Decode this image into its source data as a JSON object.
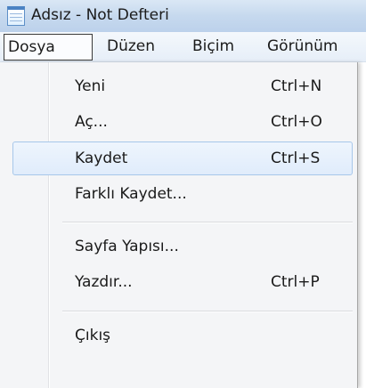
{
  "window": {
    "title": "Adsız - Not Defteri"
  },
  "menubar": {
    "items": [
      {
        "label": "Dosya",
        "active": true
      },
      {
        "label": "Düzen"
      },
      {
        "label": "Biçim"
      },
      {
        "label": "Görünüm"
      }
    ]
  },
  "file_menu": {
    "items": [
      {
        "label": "Yeni",
        "shortcut": "Ctrl+N"
      },
      {
        "label": "Aç...",
        "shortcut": "Ctrl+O"
      },
      {
        "label": "Kaydet",
        "shortcut": "Ctrl+S",
        "highlighted": true
      },
      {
        "label": "Farklı Kaydet...",
        "shortcut": ""
      },
      {
        "label": "Sayfa Yapısı...",
        "shortcut": ""
      },
      {
        "label": "Yazdır...",
        "shortcut": "Ctrl+P"
      },
      {
        "label": "Çıkış",
        "shortcut": ""
      }
    ]
  },
  "colors": {
    "highlight_border": "#a7c7ea",
    "highlight_fill": "#e0ecfb",
    "titlebar": "#c6d9ee",
    "menu_background": "#f4f5f7"
  },
  "icons": {
    "app": "notepad-icon"
  }
}
